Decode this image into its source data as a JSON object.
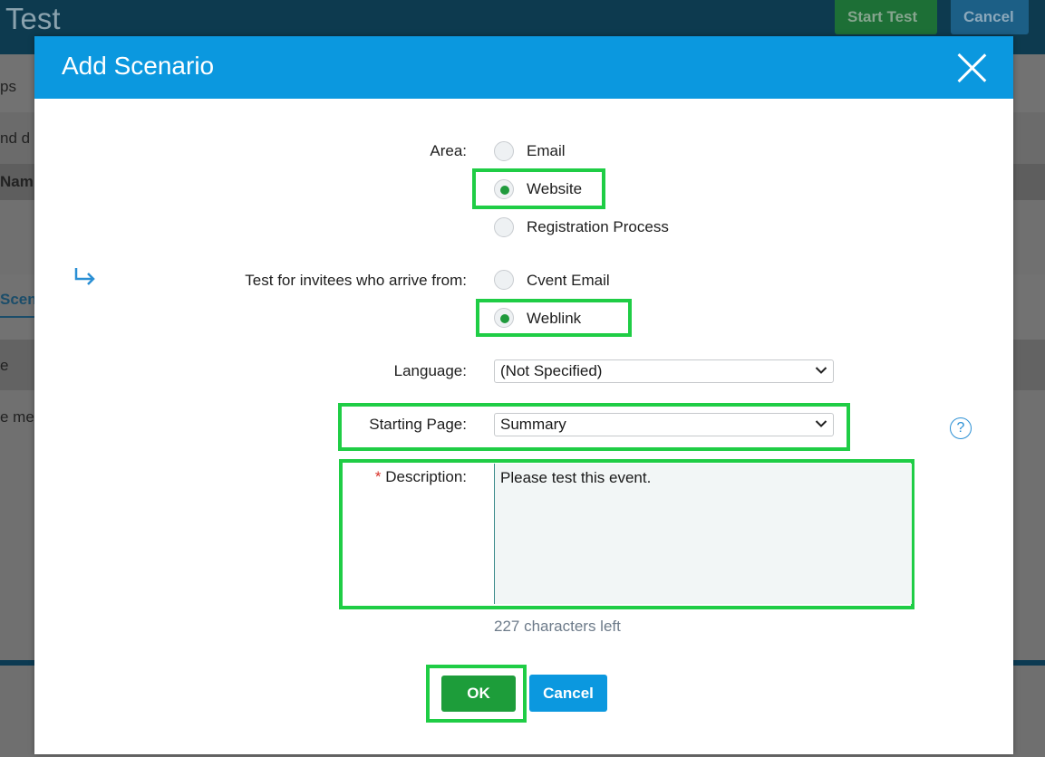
{
  "background": {
    "title": "Test",
    "start_button": "Start Test",
    "cancel_button": "Cancel",
    "row1": "ps",
    "row2": "nd d",
    "row3": "Nam",
    "row4": "Scen",
    "row5": "e",
    "row6": "e me"
  },
  "modal": {
    "title": "Add Scenario",
    "area": {
      "label": "Area:",
      "options": [
        "Email",
        "Website",
        "Registration Process"
      ],
      "selected": "Website"
    },
    "arrive_from": {
      "label": "Test for invitees who arrive from:",
      "options": [
        "Cvent Email",
        "Weblink"
      ],
      "selected": "Weblink"
    },
    "language": {
      "label": "Language:",
      "value": "(Not Specified)"
    },
    "starting_page": {
      "label": "Starting Page:",
      "value": "Summary"
    },
    "description": {
      "required_mark": "*",
      "label": "Description:",
      "value": "Please test this event.",
      "counter": "227 characters left"
    },
    "help_icon": "?",
    "ok_button": "OK",
    "cancel_button": "Cancel"
  },
  "colors": {
    "header_blue": "#0b98df",
    "ok_green": "#1d9d3a",
    "highlight_green": "#1fcd45",
    "radio_selected": "#1f9a3c"
  }
}
